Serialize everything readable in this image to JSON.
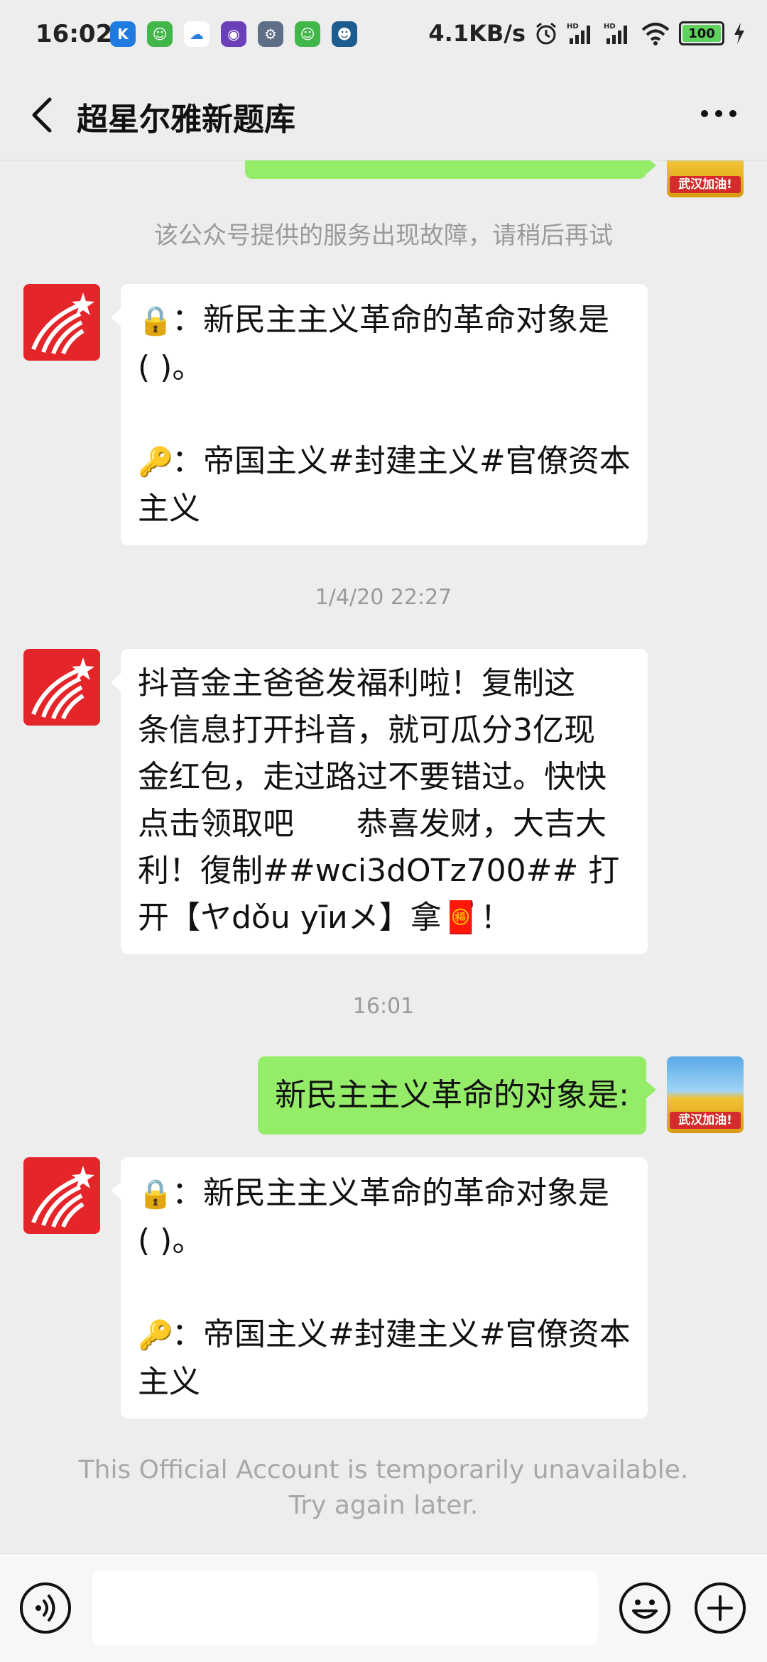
{
  "status_bar": {
    "time": "16:02",
    "speed": "4.1KB/s",
    "battery": "100",
    "app_icons": [
      {
        "name": "k-app-icon",
        "letter": "K",
        "color": "#1f7be0"
      },
      {
        "name": "frog-app-icon",
        "letter": "☺",
        "color": "#41b649"
      },
      {
        "name": "cloud-app-icon",
        "letter": "☁",
        "color": "#ffffff"
      },
      {
        "name": "camera-app-icon",
        "letter": "◉",
        "color": "#6a3fb8"
      },
      {
        "name": "settings-app-icon",
        "letter": "⚙",
        "color": "#5d6e86"
      },
      {
        "name": "frog2-app-icon",
        "letter": "☺",
        "color": "#41b649"
      },
      {
        "name": "cat-app-icon",
        "letter": "☻",
        "color": "#1d5c8f"
      }
    ]
  },
  "nav": {
    "title": "超星尔雅新题库"
  },
  "chat": {
    "top_service_notice": "该公众号提供的服务出现故障，请稍后再试",
    "msg1": {
      "lines": [
        {
          "emoji": "🔒",
          "text": "：新民主主义革命的革命对象是"
        },
        {
          "emoji": "",
          "text": "( )。"
        },
        {
          "emoji": "",
          "text": " "
        },
        {
          "emoji": "🔑",
          "text": "：帝国主义#封建主义#官僚资本"
        },
        {
          "emoji": "",
          "text": "主义"
        }
      ]
    },
    "timestamp1": "1/4/20 22:27",
    "msg2": {
      "lines": [
        "抖音金主爸爸发福利啦！复制这",
        "条信息打开抖音，就可瓜分3亿现",
        "金红包，走过路过不要错过。快快",
        "点击领取吧　　恭喜发财，大吉大",
        "利！復制##wci3dOTz700## 打",
        "开【ヤdǒu yīиメ】拿🧧！"
      ]
    },
    "timestamp2": "16:01",
    "user_msg": "新民主主义革命的对象是:",
    "user_avatar_badge": "武汉加油!",
    "msg3": {
      "lines": [
        {
          "emoji": "🔒",
          "text": "：新民主主义革命的革命对象是"
        },
        {
          "emoji": "",
          "text": "( )。"
        },
        {
          "emoji": "",
          "text": " "
        },
        {
          "emoji": "🔑",
          "text": "：帝国主义#封建主义#官僚资本"
        },
        {
          "emoji": "",
          "text": "主义"
        }
      ]
    },
    "unavailable_notice": [
      "This Official Account is temporarily unavailable.",
      "Try again later."
    ]
  },
  "colors": {
    "background": "#ededed",
    "user_bubble": "#95ec69",
    "bot_avatar": "#e4262a"
  }
}
